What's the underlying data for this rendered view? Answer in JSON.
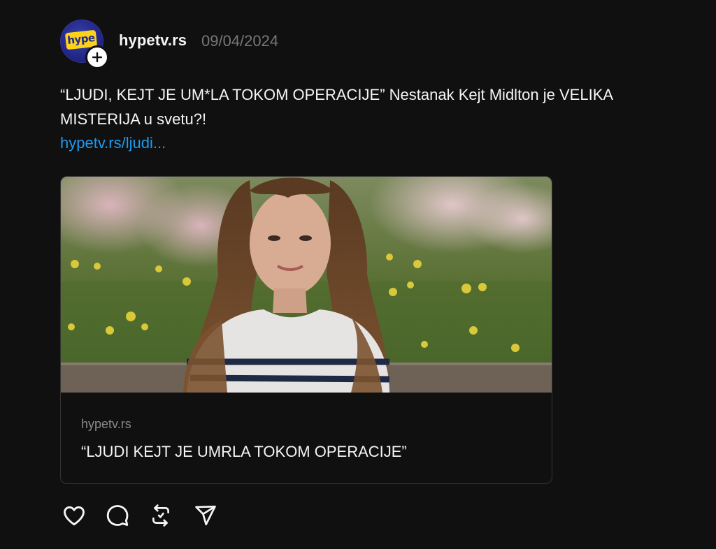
{
  "post": {
    "avatar_logo_text": "hype",
    "username": "hypetv.rs",
    "date": "09/04/2024",
    "text": "“LJUDI, KEJT JE UM*LA TOKOM OPERACIJE” Nestanak Kejt Midlton je VELIKA MISTERIJA u svetu?!",
    "link_text": "hypetv.rs/ljudi..."
  },
  "card": {
    "domain": "hypetv.rs",
    "title": "“LJUDI KEJT JE UMRLA TOKOM OPERACIJE”"
  },
  "actions": [
    {
      "icon": "heart-icon"
    },
    {
      "icon": "comment-icon"
    },
    {
      "icon": "repost-icon"
    },
    {
      "icon": "share-icon"
    }
  ],
  "colors": {
    "background": "#101010",
    "text": "#f3f5f7",
    "muted": "#777777",
    "link": "#1d9bf0",
    "card_border": "#343434"
  }
}
